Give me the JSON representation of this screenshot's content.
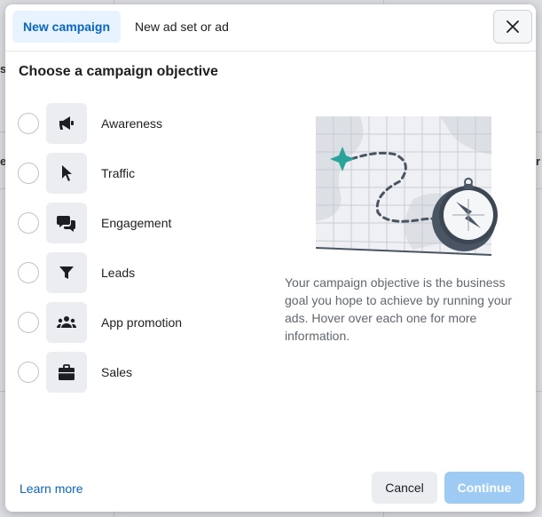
{
  "background": {
    "left_fragments": [
      "s",
      "e"
    ],
    "right_fragments": [
      "r"
    ]
  },
  "tabs": [
    {
      "label": "New campaign",
      "active": true
    },
    {
      "label": "New ad set or ad",
      "active": false
    }
  ],
  "close_icon": "close-icon",
  "heading": "Choose a campaign objective",
  "objectives": [
    {
      "label": "Awareness",
      "icon": "megaphone-icon"
    },
    {
      "label": "Traffic",
      "icon": "cursor-icon"
    },
    {
      "label": "Engagement",
      "icon": "chat-bubbles-icon"
    },
    {
      "label": "Leads",
      "icon": "funnel-icon"
    },
    {
      "label": "App promotion",
      "icon": "people-icon"
    },
    {
      "label": "Sales",
      "icon": "shopping-bag-icon"
    }
  ],
  "illustration": "map-compass-illustration",
  "description": "Your campaign objective is the business goal you hope to achieve by running your ads. Hover over each one for more information.",
  "footer": {
    "learn_more": "Learn more",
    "cancel": "Cancel",
    "continue": "Continue"
  },
  "colors": {
    "accent": "#0a66c2",
    "tab_active_bg": "#e7f3ff",
    "continue_disabled_bg": "#9ecbf4",
    "teal": "#2aa39b"
  }
}
